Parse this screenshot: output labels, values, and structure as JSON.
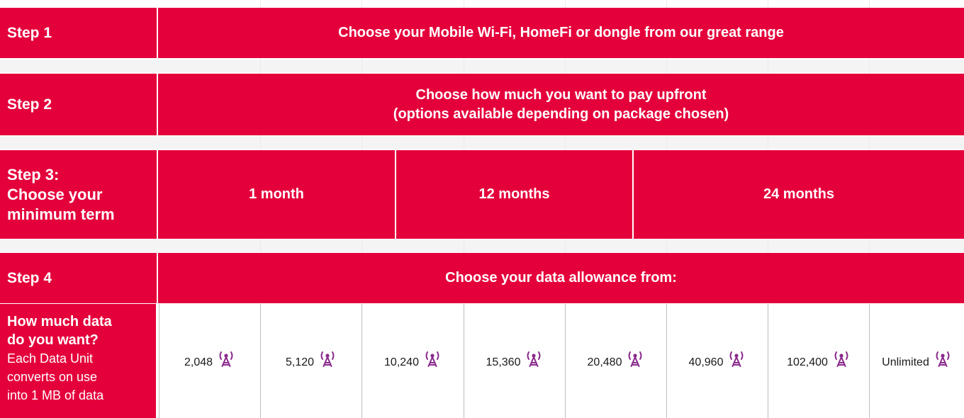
{
  "steps": [
    {
      "label": "Step 1",
      "content": "Choose your Mobile Wi-Fi, HomeFi or dongle from our great range"
    },
    {
      "label": "Step 2",
      "content_line1": "Choose how much you want to pay upfront",
      "content_line2": "(options available depending on package chosen)"
    },
    {
      "label_lines": [
        "Step 3:",
        "Choose your",
        "minimum term"
      ],
      "terms": [
        "1 month",
        "12 months",
        "24 months"
      ]
    },
    {
      "label": "Step 4",
      "content": "Choose your data allowance from:"
    }
  ],
  "data_row": {
    "label_bold_lines": [
      "How much data",
      "do you want?"
    ],
    "label_lines": [
      "Each Data Unit",
      "converts on use",
      "into 1 MB of data"
    ],
    "options": [
      {
        "value": "2,048",
        "icon": "data-unit-icon"
      },
      {
        "value": "5,120",
        "icon": "data-unit-icon"
      },
      {
        "value": "10,240",
        "icon": "data-unit-icon"
      },
      {
        "value": "15,360",
        "icon": "data-unit-icon"
      },
      {
        "value": "20,480",
        "icon": "data-unit-icon"
      },
      {
        "value": "40,960",
        "icon": "data-unit-icon"
      },
      {
        "value": "102,400",
        "icon": "data-unit-icon"
      },
      {
        "value": "Unlimited",
        "icon": "data-unit-icon"
      }
    ]
  },
  "colors": {
    "brand_red": "#e4003b",
    "icon_purple": "#8a2a8c",
    "text": "#1a1a1a"
  }
}
